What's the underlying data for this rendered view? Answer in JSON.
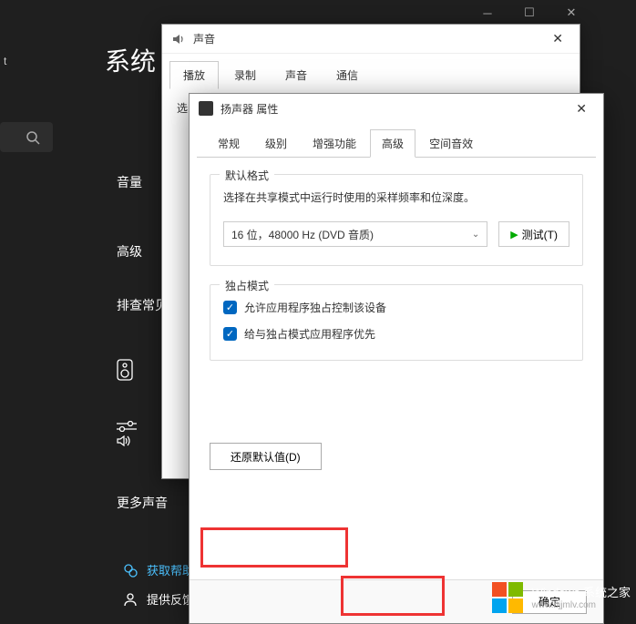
{
  "settings": {
    "title": "系统",
    "account_label": "t",
    "sidebar": {
      "volume": "音量",
      "advanced": "高级",
      "troubleshoot": "排查常见",
      "more_sound": "更多声音"
    },
    "help": "获取帮助",
    "feedback": "提供反馈"
  },
  "sound_dialog": {
    "title": "声音",
    "tabs": [
      "播放",
      "录制",
      "声音",
      "通信"
    ],
    "active_tab": 0,
    "body_select": "选"
  },
  "speaker_dialog": {
    "title": "扬声器 属性",
    "tabs": [
      "常规",
      "级别",
      "增强功能",
      "高级",
      "空间音效"
    ],
    "active_tab": 3,
    "default_format": {
      "title": "默认格式",
      "desc": "选择在共享模式中运行时使用的采样频率和位深度。",
      "selected": "16 位，48000 Hz (DVD 音质)",
      "test_btn": "测试(T)"
    },
    "exclusive": {
      "title": "独占模式",
      "opt1": "允许应用程序独占控制该设备",
      "opt1_checked": true,
      "opt2": "给与独占模式应用程序优先",
      "opt2_checked": true
    },
    "restore_btn": "还原默认值(D)",
    "ok_btn": "确定"
  },
  "watermark": {
    "line1": "Windows 系统之家",
    "line2": "www.bjjmlv.com"
  }
}
